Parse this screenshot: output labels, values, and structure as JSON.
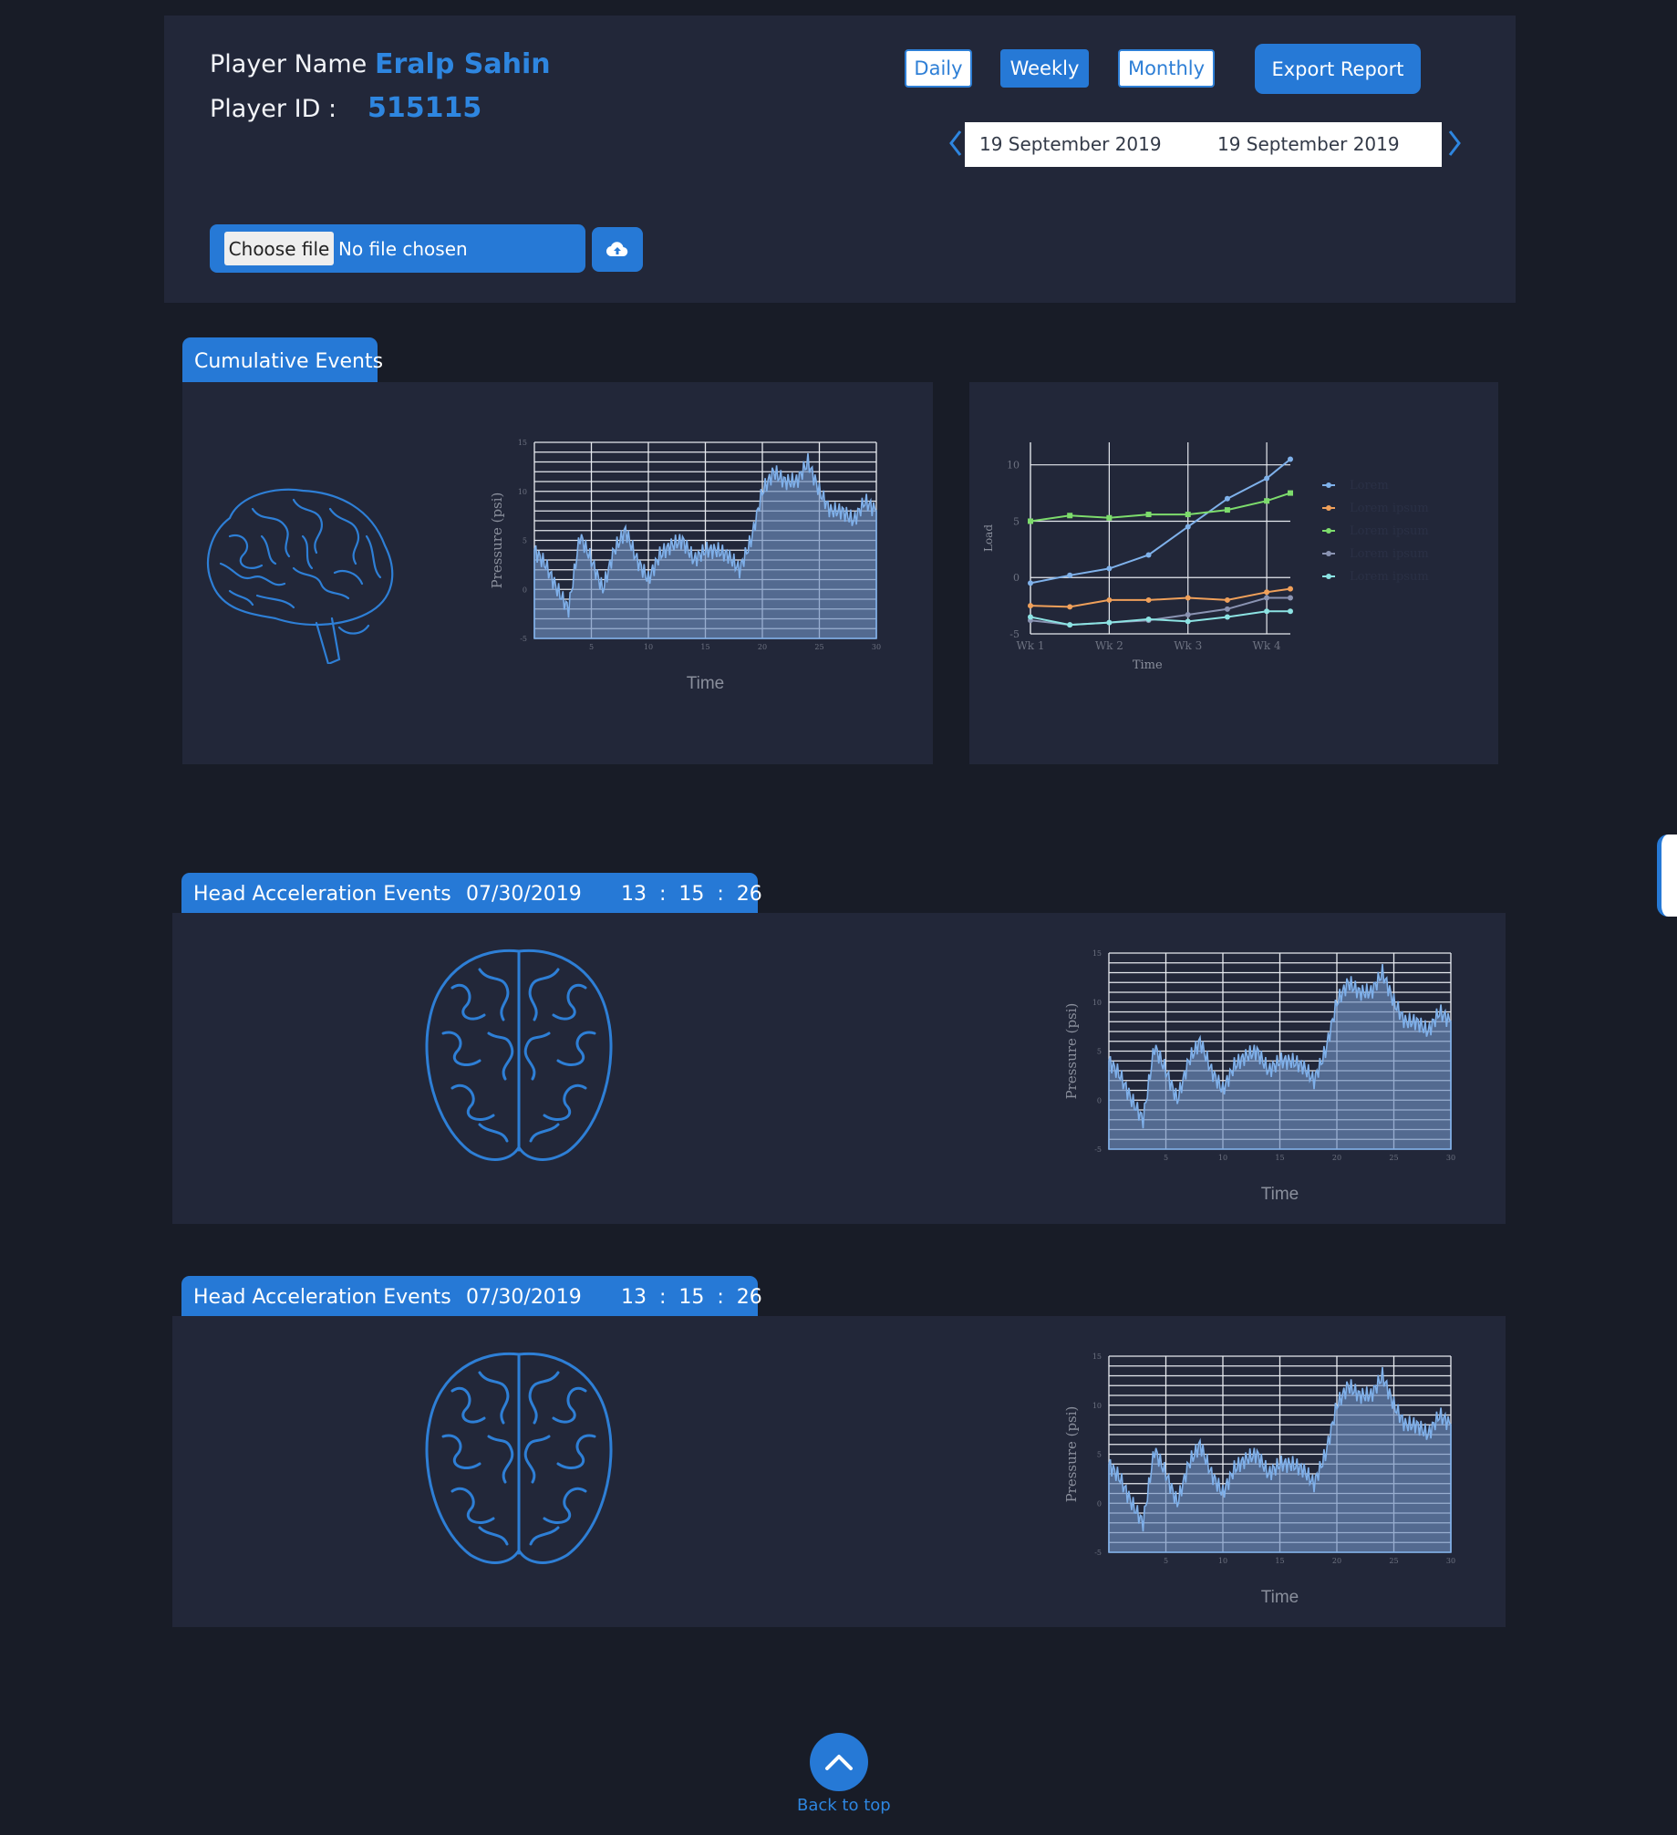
{
  "player": {
    "name_label": "Player Name :",
    "name_value": "Eralp Sahin",
    "id_label": "Player ID :",
    "id_value": "515115"
  },
  "period_buttons": {
    "daily": "Daily",
    "weekly": "Weekly",
    "monthly": "Monthly",
    "active": "weekly"
  },
  "export_label": "Export Report",
  "date_range": {
    "start": "19 September 2019",
    "end": "19 September 2019"
  },
  "file_input": {
    "button_label": "Choose file",
    "status": "No file chosen"
  },
  "icons": {
    "upload": "cloud-upload-icon",
    "prev": "chevron-left-icon",
    "next": "chevron-right-icon",
    "brain_side": "brain-side-view-icon",
    "brain_top": "brain-top-view-icon",
    "back_to_top": "chevron-up-icon"
  },
  "colors": {
    "accent": "#2679d6",
    "accent_text": "#2e86e0",
    "background": "#181c27",
    "panel": "#222739"
  },
  "cumulative": {
    "tab_label": "Cumulative Events"
  },
  "events": [
    {
      "tab_label": "Head Acceleration Events",
      "date": "07/30/2019",
      "time": "13  :  15  :  26"
    },
    {
      "tab_label": "Head Acceleration Events",
      "date": "07/30/2019",
      "time": "13  :  15  :  26"
    }
  ],
  "back_to_top_label": "Back to top",
  "chart_data": [
    {
      "type": "area",
      "xlabel": "Time",
      "ylabel": "Pressure (psi)",
      "xlim": [
        0,
        30
      ],
      "ylim": [
        -5,
        15
      ],
      "x_ticks": [
        5,
        10,
        15,
        20,
        25,
        30
      ],
      "y_ticks": [
        -5,
        0,
        5,
        10,
        15
      ],
      "x": [
        0,
        1,
        2,
        3,
        4,
        5,
        6,
        7,
        8,
        9,
        10,
        11,
        12,
        13,
        14,
        15,
        16,
        17,
        18,
        19,
        20,
        21,
        22,
        23,
        24,
        25,
        26,
        27,
        28,
        29,
        30
      ],
      "y": [
        4,
        2.5,
        0,
        -2,
        5.5,
        3,
        0,
        4,
        6,
        3,
        1,
        3.5,
        4.5,
        5,
        3,
        4,
        4,
        3.5,
        2,
        5,
        10,
        12,
        11,
        11,
        13,
        10,
        8,
        8,
        7,
        9,
        8
      ]
    },
    {
      "type": "line",
      "xlabel": "Time",
      "ylabel": "Load",
      "categories": [
        "Wk 1",
        "Wk 2",
        "Wk 3",
        "Wk 4"
      ],
      "y_ticks": [
        -5,
        0,
        5,
        10
      ],
      "ylim": [
        -5,
        12
      ],
      "x": [
        0,
        0.5,
        1,
        1.5,
        2,
        2.5,
        3,
        3.3
      ],
      "series": [
        {
          "name": "Lorem",
          "color": "#7fb1ea",
          "values": [
            -0.5,
            0.2,
            0.8,
            2,
            4.5,
            7,
            8.8,
            10.5
          ]
        },
        {
          "name": "Lorem ipsum",
          "color": "#f0a05a",
          "values": [
            -2.5,
            -2.6,
            -2,
            -2,
            -1.8,
            -2,
            -1.3,
            -1
          ]
        },
        {
          "name": "Lorem ipsum",
          "color": "#7ddc6c",
          "values": [
            5,
            5.5,
            5.3,
            5.6,
            5.6,
            6,
            6.8,
            7.5
          ]
        },
        {
          "name": "Lorem ipsum",
          "color": "#8a93b2",
          "values": [
            -3.8,
            -4.2,
            -4,
            -3.8,
            -3.3,
            -2.8,
            -1.8,
            -1.8
          ]
        },
        {
          "name": "Lorem ipsum",
          "color": "#8ce3e3",
          "values": [
            -3.5,
            -4.2,
            -4,
            -3.7,
            -3.9,
            -3.5,
            -3,
            -3
          ]
        }
      ]
    }
  ]
}
